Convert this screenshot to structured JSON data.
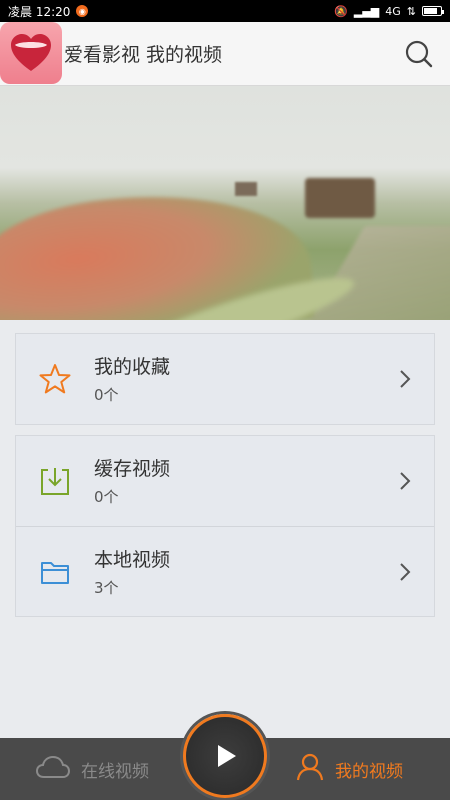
{
  "status_bar": {
    "time": "凌晨 12:20",
    "network": "4G"
  },
  "header": {
    "title": "爱看影视 我的视频"
  },
  "list_groups": [
    [
      {
        "name": "我的收藏",
        "count": "0个",
        "icon": "star-icon"
      }
    ],
    [
      {
        "name": "缓存视频",
        "count": "0个",
        "icon": "download-icon"
      },
      {
        "name": "本地视频",
        "count": "3个",
        "icon": "folder-icon"
      }
    ]
  ],
  "bottom_nav": {
    "online_label": "在线视频",
    "mine_label": "我的视频",
    "active": "mine"
  },
  "colors": {
    "accent": "#f07a1f",
    "star": "#f07a1f",
    "download": "#7aa52a",
    "folder": "#3c8fd6"
  }
}
